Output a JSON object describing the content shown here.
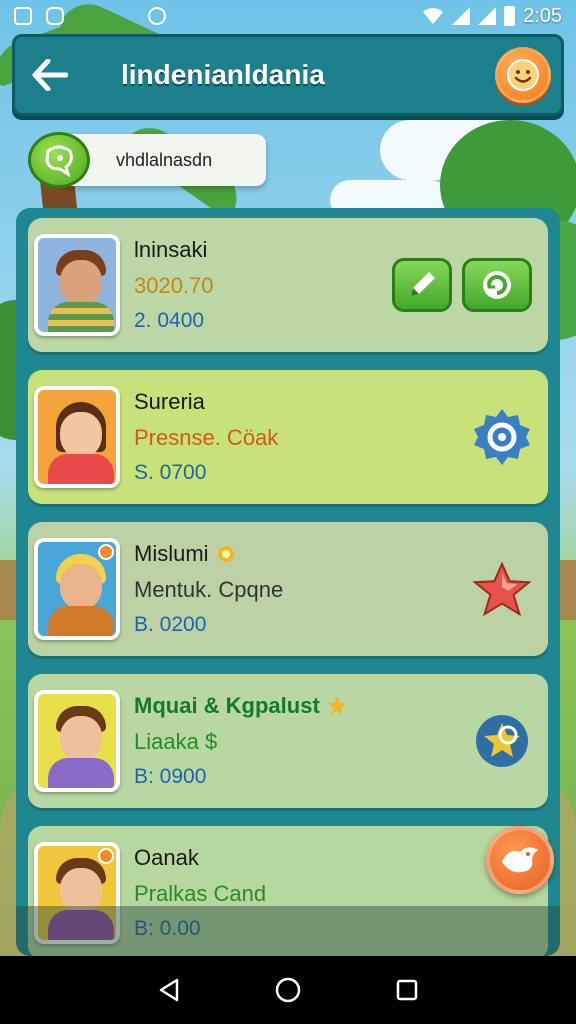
{
  "status_bar": {
    "time": "2:05"
  },
  "header": {
    "title": "lindenianldania",
    "back_icon": "arrow-left-icon",
    "profile_icon": "smiley-icon"
  },
  "search": {
    "value": "vhdlalnasdn",
    "icon": "chat-bubble-icon"
  },
  "colors": {
    "accent": "#1b7f8c",
    "orange": "#f07a1a",
    "green": "#4ea822"
  },
  "players": [
    {
      "name": "lninsaki",
      "line2": "3020.70",
      "line3": "2. 0400",
      "actions": [
        "edit-icon",
        "refresh-icon"
      ]
    },
    {
      "name": "Sureria",
      "line2": "Presnse. Cöak",
      "line3": "S. 0700",
      "actions": [
        "settings-icon"
      ]
    },
    {
      "name": "Mislumi",
      "line2": "Mentuk. Cpqne",
      "line3": "B. 0200",
      "actions": [
        "star-icon"
      ]
    },
    {
      "name": "Mquai & Kgpalust",
      "line2": "Liaaka $",
      "line3": "B: 0900",
      "actions": [
        "badge-icon"
      ]
    },
    {
      "name": "Oanak",
      "line2": "Pralkas Cand",
      "line3": "B: 0.00",
      "actions": []
    }
  ],
  "fab": {
    "icon": "bird-icon"
  },
  "nav": {
    "back": "nav-back-icon",
    "home": "nav-home-icon",
    "recents": "nav-recents-icon"
  }
}
